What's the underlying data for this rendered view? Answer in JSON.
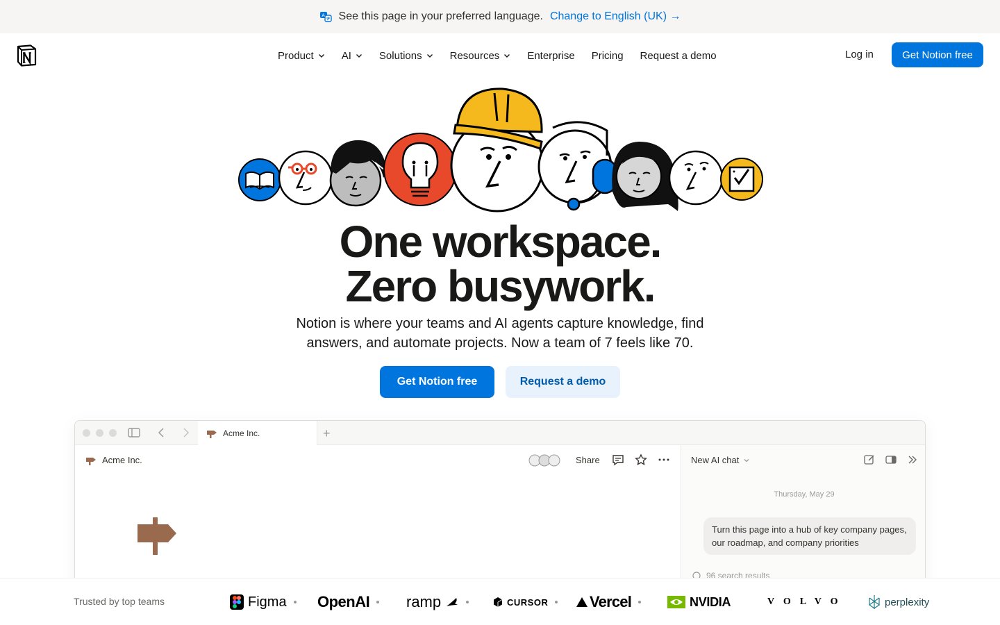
{
  "banner": {
    "message": "See this page in your preferred language.",
    "link": "Change to English (UK) →"
  },
  "nav": {
    "items": [
      {
        "label": "Product",
        "dropdown": true
      },
      {
        "label": "AI",
        "dropdown": true
      },
      {
        "label": "Solutions",
        "dropdown": true
      },
      {
        "label": "Resources",
        "dropdown": true
      },
      {
        "label": "Enterprise",
        "dropdown": false
      },
      {
        "label": "Pricing",
        "dropdown": false
      },
      {
        "label": "Request a demo",
        "dropdown": false
      }
    ],
    "login": "Log in",
    "cta": "Get Notion free"
  },
  "hero": {
    "headline_line1": "One workspace.",
    "headline_line2": "Zero busywork.",
    "subhead": "Notion is where your teams and AI agents capture knowledge, find answers, and automate projects. Now a team of 7 feels like 70.",
    "primary_cta": "Get Notion free",
    "secondary_cta": "Request a demo"
  },
  "app": {
    "tab_title": "Acme Inc.",
    "breadcrumb": "Acme Inc.",
    "share": "Share",
    "ai_chat": {
      "title": "New AI chat",
      "date": "Thursday, May 29",
      "message": "Turn this page into a hub of key company pages, our roadmap, and company priorities",
      "results": "96 search results"
    }
  },
  "trusted": {
    "label": "Trusted by top teams",
    "logos": [
      "Figma",
      "OpenAI",
      "ramp",
      "CURSOR",
      "Vercel",
      "NVIDIA",
      "VOLVO",
      "perplexity"
    ]
  },
  "colors": {
    "primary": "#0075de",
    "secondary_bg": "#e8f2fc",
    "banner_bg": "#f6f5f4",
    "text": "#191918"
  }
}
